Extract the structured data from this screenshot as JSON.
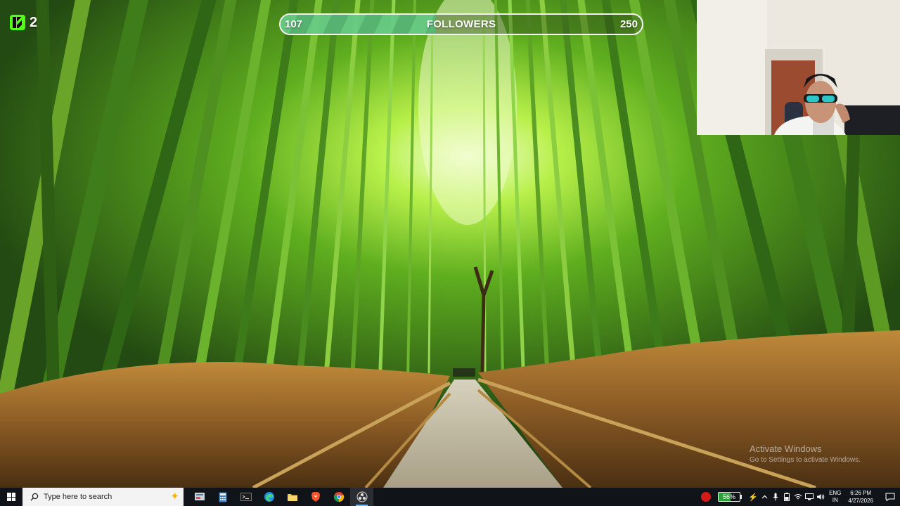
{
  "overlay": {
    "kick": {
      "viewer_count": "2",
      "brand_color": "#53fc18"
    },
    "follower_goal": {
      "current": "107",
      "label": "FOLLOWERS",
      "target": "250",
      "progress_fraction": 0.428
    }
  },
  "watermark": {
    "title": "Activate Windows",
    "subtitle": "Go to Settings to activate Windows."
  },
  "taskbar": {
    "search_placeholder": "Type here to search",
    "apps": [
      {
        "name": "task-view-icon"
      },
      {
        "name": "calculator-icon"
      },
      {
        "name": "terminal-icon"
      },
      {
        "name": "edge-browser-icon"
      },
      {
        "name": "file-explorer-icon"
      },
      {
        "name": "brave-browser-icon"
      },
      {
        "name": "chrome-browser-icon"
      },
      {
        "name": "obs-studio-icon"
      }
    ],
    "tray": {
      "battery_percent": "56%",
      "battery_level": 0.56,
      "language_line1": "ENG",
      "language_line2": "IN",
      "time": "6:26 PM",
      "date": "4/27/2026"
    }
  }
}
